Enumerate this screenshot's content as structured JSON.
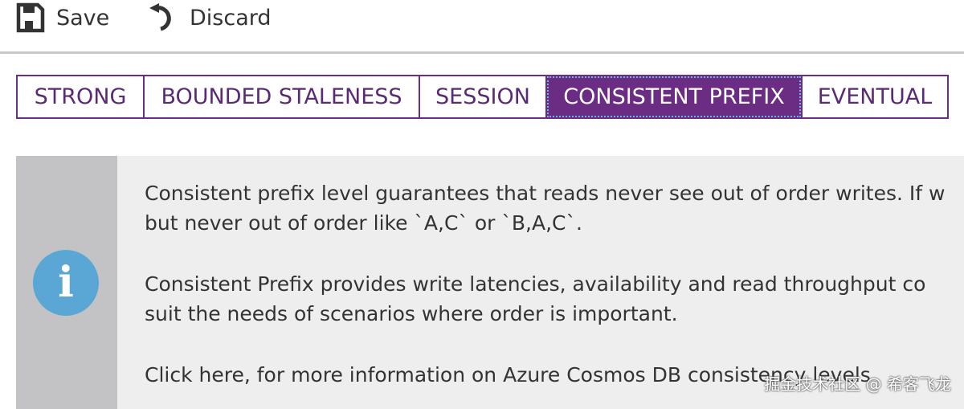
{
  "toolbar": {
    "save_label": "Save",
    "discard_label": "Discard"
  },
  "icons": {
    "save": "floppy-disk-icon",
    "discard": "undo-icon",
    "info": "info-icon"
  },
  "consistency_tabs": [
    {
      "label": "STRONG",
      "active": false
    },
    {
      "label": "BOUNDED STALENESS",
      "active": false
    },
    {
      "label": "SESSION",
      "active": false
    },
    {
      "label": "CONSISTENT PREFIX",
      "active": true
    },
    {
      "label": "EVENTUAL",
      "active": false
    }
  ],
  "info": {
    "paragraph1_line1": "Consistent prefix level guarantees that reads never see out of order writes. If w",
    "paragraph1_line2": "but never out of order like `A,C` or `B,A,C`.",
    "paragraph2_line1": "Consistent Prefix provides write latencies, availability and read throughput co",
    "paragraph2_line2": "suit the needs of scenarios where order is important.",
    "link_text": "Click here, for more information on Azure Cosmos DB consistency levels"
  },
  "watermark": "掘金技术社区 @ 希客飞龙",
  "colors": {
    "accent": "#6b2c84",
    "tab_text": "#5a2a75",
    "info_panel": "#eeeeee",
    "info_sidebar": "#c3c3c6",
    "info_icon": "#5aa7d6",
    "divider": "#c8c8c8"
  }
}
